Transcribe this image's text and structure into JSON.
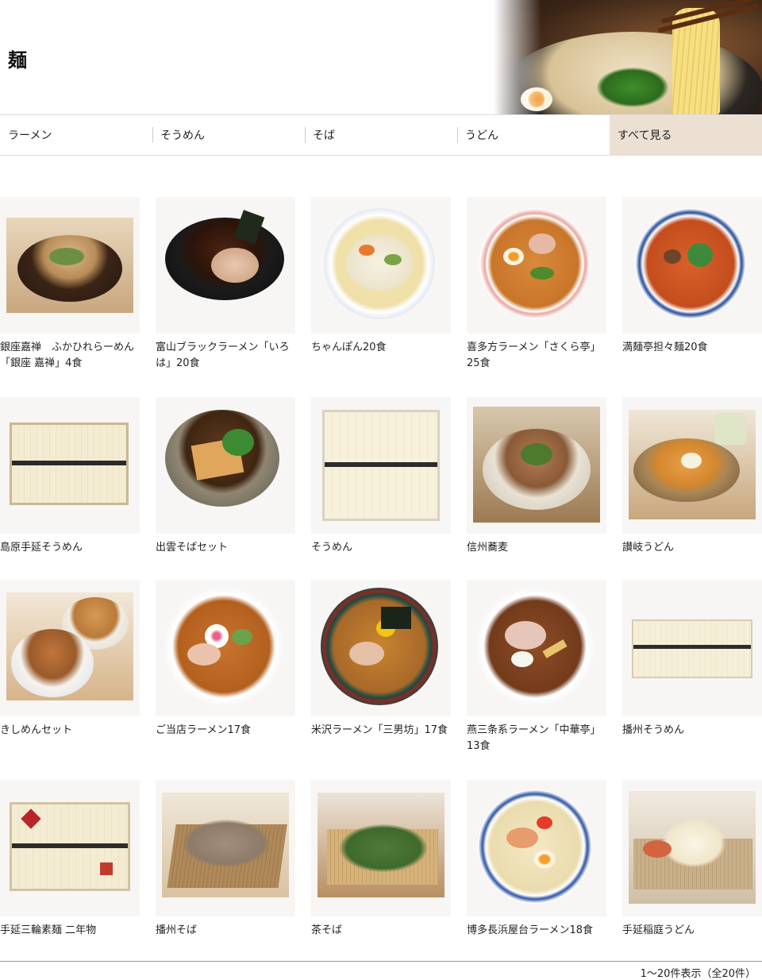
{
  "page": {
    "title": "麺"
  },
  "categories": [
    {
      "label": "ラーメン"
    },
    {
      "label": "そうめん"
    },
    {
      "label": "そば"
    },
    {
      "label": "うどん"
    },
    {
      "label": "すべて見る"
    }
  ],
  "products": [
    {
      "name": "銀座嘉禅　ふかひれらーめん「銀座 嘉禅」4食"
    },
    {
      "name": "富山ブラックラーメン「いろは」20食"
    },
    {
      "name": "ちゃんぽん20食"
    },
    {
      "name": "喜多方ラーメン「さくら亭」25食"
    },
    {
      "name": "満麺亭担々麺20食"
    },
    {
      "name": "島原手延そうめん"
    },
    {
      "name": "出雲そばセット"
    },
    {
      "name": "そうめん"
    },
    {
      "name": "信州蕎麦"
    },
    {
      "name": "讃岐うどん"
    },
    {
      "name": "きしめんセット"
    },
    {
      "name": "ご当店ラーメン17食"
    },
    {
      "name": "米沢ラーメン「三男坊」17食"
    },
    {
      "name": "燕三条系ラーメン「中華亭」13食"
    },
    {
      "name": "播州そうめん"
    },
    {
      "name": "手延三輪素麺 二年物"
    },
    {
      "name": "播州そば"
    },
    {
      "name": "茶そば"
    },
    {
      "name": "博多長浜屋台ラーメン18食"
    },
    {
      "name": "手延稲庭うどん"
    }
  ],
  "pagination": {
    "summary": "1～20件表示（全20件）"
  }
}
